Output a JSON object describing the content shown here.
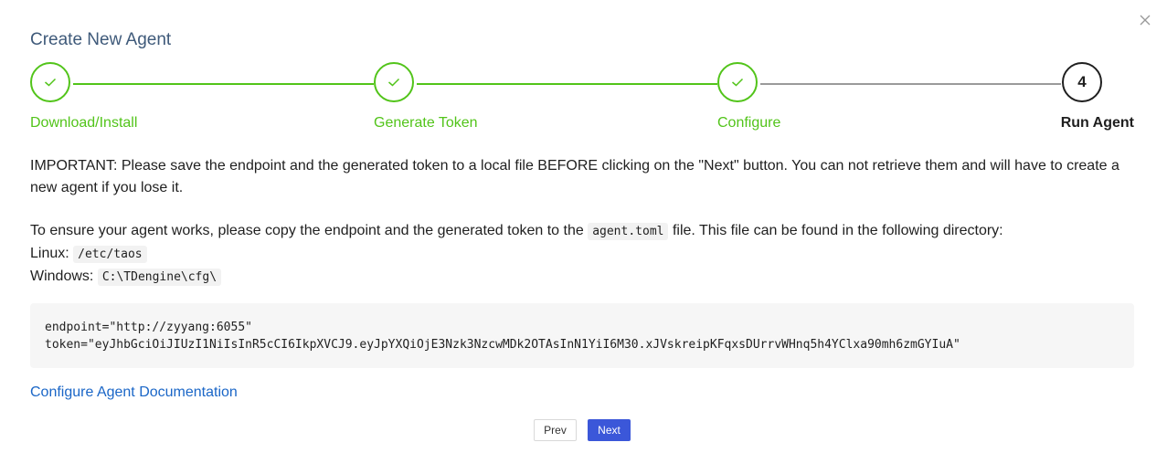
{
  "dialog": {
    "title": "Create New Agent"
  },
  "steps": [
    {
      "label": "Download/Install",
      "status": "done"
    },
    {
      "label": "Generate Token",
      "status": "done"
    },
    {
      "label": "Configure",
      "status": "done"
    },
    {
      "label": "Run Agent",
      "status": "current",
      "number": "4"
    }
  ],
  "content": {
    "important": "IMPORTANT: Please save the endpoint and the generated token to a local file BEFORE clicking on the \"Next\" button. You can not retrieve them and will have to create a",
    "important_cont": "new agent if you lose it.",
    "ensure_before": "To ensure your agent works, please copy the endpoint and the generated token to the",
    "config_file": "agent.toml",
    "ensure_after": "file. This file can be found in the following directory:",
    "linux_label": "Linux:",
    "linux_path": "/etc/taos",
    "windows_label": "Windows:",
    "windows_path": "C:\\TDengine\\cfg\\",
    "endpoint_line": "endpoint=\"http://zyyang:6055\"",
    "token_line": "token=\"eyJhbGciOiJIUzI1NiIsInR5cCI6IkpXVCJ9.eyJpYXQiOjE3Nzk3NzcwMDk2OTAsInN1YiI6M30.xJVskreipKFqxsDUrrvWHnq5h4YClxa90mh6zmGYIuA\"",
    "doc_link": "Configure Agent Documentation"
  },
  "buttons": {
    "prev": "Prev",
    "next": "Next"
  },
  "colors": {
    "done": "#52c41a",
    "title": "#3f5a7a",
    "link": "#1a66c7",
    "primary": "#3b57d9"
  },
  "icons": {
    "close": "close-icon",
    "check": "check-icon"
  }
}
